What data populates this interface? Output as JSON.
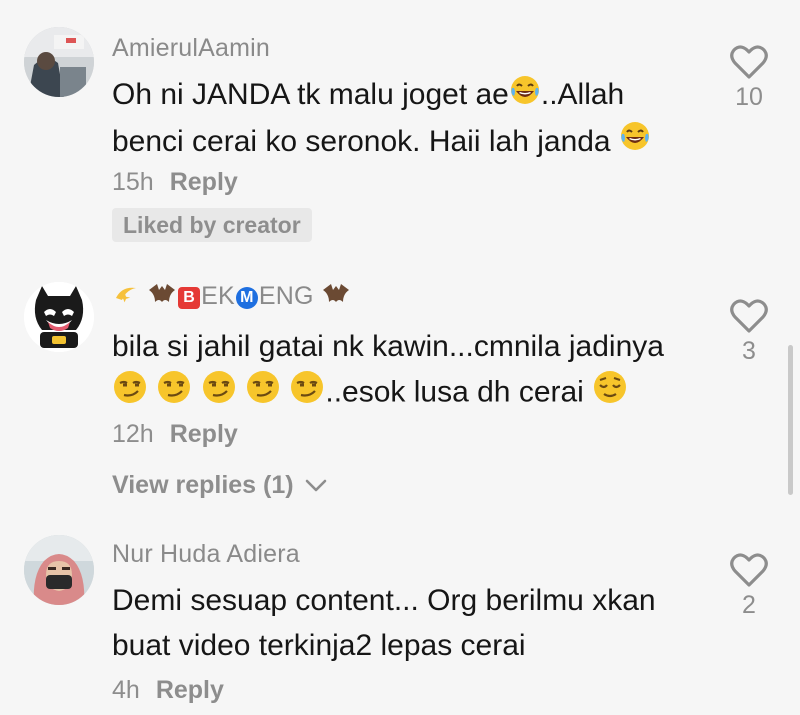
{
  "comments": [
    {
      "username": "AmierulAamin",
      "lines": [
        "Oh ni JANDA tk malu joget ae",
        "..Allah",
        "benci cerai ko seronok. Haii lah janda "
      ],
      "time": "15h",
      "reply_label": "Reply",
      "liked_badge": "Liked by creator",
      "like_count": "10"
    },
    {
      "username_parts": [
        "EK",
        "ENG"
      ],
      "username_letters": [
        "B",
        "M"
      ],
      "lines": [
        "bila si jahil gatai nk kawin...cmnila jadinya",
        "..esok lusa dh cerai "
      ],
      "time": "12h",
      "reply_label": "Reply",
      "view_replies": "View replies (1)",
      "like_count": "3"
    },
    {
      "username": "Nur Huda Adiera",
      "lines": [
        "Demi sesuap content... Org berilmu xkan",
        "buat video terkinja2 lepas cerai"
      ],
      "time": "4h",
      "reply_label": "Reply",
      "like_count": "2"
    }
  ],
  "icons": {
    "like": "heart-outline-icon",
    "laugh_emoji": "tears-of-joy-emoji",
    "smirk_emoji": "smirking-face-emoji",
    "relieved_emoji": "relieved-face-emoji",
    "dizzy_emoji": "dizzy-emoji",
    "bat_emoji": "bat-emoji",
    "chevron": "chevron-down-icon"
  },
  "colors": {
    "username": "#8a8a8a",
    "text": "#161616",
    "meta": "#8d8d8d",
    "background": "#f6f6f6",
    "badge_b": "#e53935",
    "badge_m": "#1e6fe0"
  }
}
